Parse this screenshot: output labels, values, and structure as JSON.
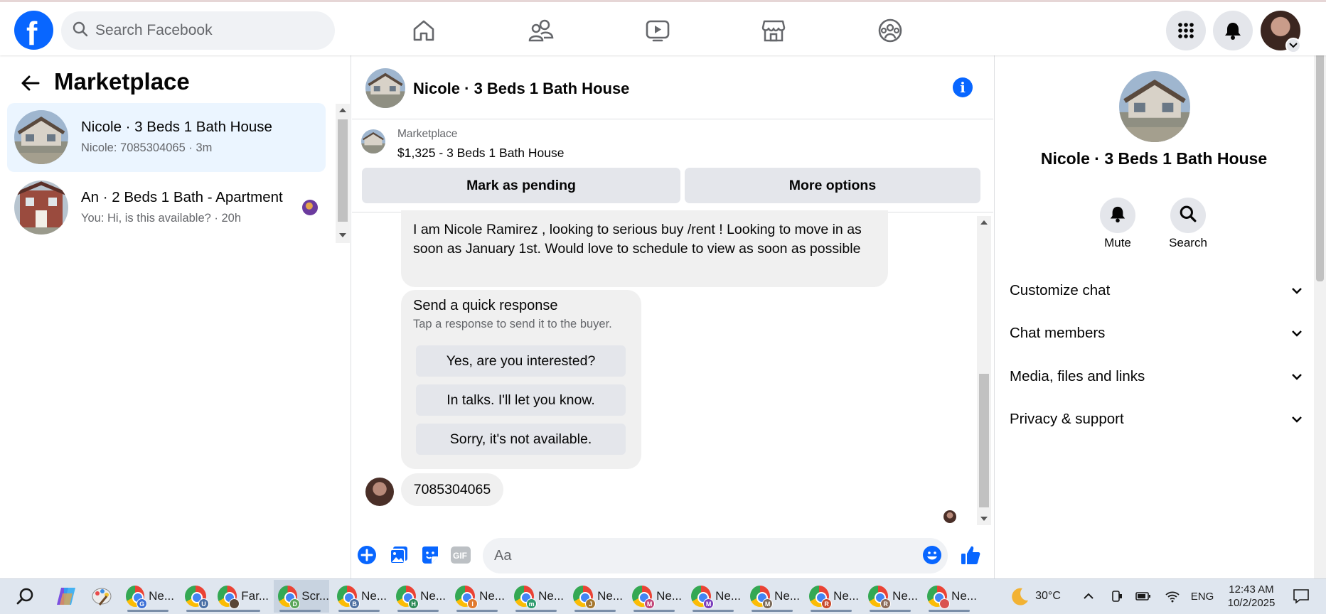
{
  "topbar": {
    "search_placeholder": "Search Facebook",
    "nav_icons": [
      "home-icon",
      "friends-icon",
      "watch-icon",
      "marketplace-icon",
      "groups-icon"
    ],
    "right_icons": [
      "menu-grid-icon",
      "notifications-bell-icon",
      "account-avatar"
    ]
  },
  "left": {
    "title": "Marketplace",
    "conversations": [
      {
        "name": "Nicole · 3 Beds 1 Bath House",
        "sub": "Nicole: 7085304065 · 3m",
        "active": true
      },
      {
        "name": "An · 2 Beds 1 Bath - Apartment",
        "sub": "You: Hi, is this available? · 20h",
        "active": false
      }
    ]
  },
  "chat": {
    "title": "Nicole · 3 Beds 1 Bath House",
    "listing": {
      "source": "Marketplace",
      "title": "$1,325 - 3 Beds 1 Bath House",
      "mark_pending": "Mark as pending",
      "more_options": "More options"
    },
    "intro_message": "I am Nicole Ramirez , looking to serious buy /rent ! Looking to move in as soon as January 1st. Would love to schedule to view as soon as possible",
    "quick_response": {
      "title": "Send a quick response",
      "subtitle": "Tap a response to send it to the buyer.",
      "options": [
        "Yes, are you interested?",
        "In talks. I'll let you know.",
        "Sorry, it's not available."
      ]
    },
    "phone_message": "7085304065",
    "composer_placeholder": "Aa"
  },
  "right": {
    "title": "Nicole · 3 Beds 1 Bath House",
    "actions": [
      {
        "label": "Mute",
        "icon": "bell-icon"
      },
      {
        "label": "Search",
        "icon": "search-icon"
      }
    ],
    "sections": [
      "Customize chat",
      "Chat members",
      "Media, files and links",
      "Privacy & support"
    ]
  },
  "taskbar": {
    "apps": [
      {
        "label": "Ne...",
        "badge": "G",
        "badge_color": "#3b6fd6"
      },
      {
        "label": "",
        "badge": "U",
        "badge_color": "#4a6fa5"
      },
      {
        "label": "Far...",
        "badge": "",
        "badge_color": "#5a4636"
      },
      {
        "label": "Scr...",
        "badge": "D",
        "badge_color": "#5aa55a"
      },
      {
        "label": "Ne...",
        "badge": "B",
        "badge_color": "#4d6fa0"
      },
      {
        "label": "Ne...",
        "badge": "H",
        "badge_color": "#2e8b57"
      },
      {
        "label": "Ne...",
        "badge": "I",
        "badge_color": "#e07a2e"
      },
      {
        "label": "Ne...",
        "badge": "m",
        "badge_color": "#2e9b6e"
      },
      {
        "label": "Ne...",
        "badge": "J",
        "badge_color": "#a5772e"
      },
      {
        "label": "Ne...",
        "badge": "M",
        "badge_color": "#c2477a"
      },
      {
        "label": "Ne...",
        "badge": "M",
        "badge_color": "#7a3ebd"
      },
      {
        "label": "Ne...",
        "badge": "M",
        "badge_color": "#7a6a5a"
      },
      {
        "label": "Ne...",
        "badge": "R",
        "badge_color": "#c84a2e"
      },
      {
        "label": "Ne...",
        "badge": "R",
        "badge_color": "#8a6a5a"
      },
      {
        "label": "Ne...",
        "badge": "",
        "badge_color": "#d9534f"
      }
    ],
    "weather": "30°C",
    "language": "ENG",
    "time": "12:43 AM",
    "date": "10/2/2025"
  },
  "colors": {
    "brand": "#0866ff",
    "active_conv": "#ebf5ff",
    "bubble": "#f0f0f0",
    "button": "#e4e6eb"
  }
}
